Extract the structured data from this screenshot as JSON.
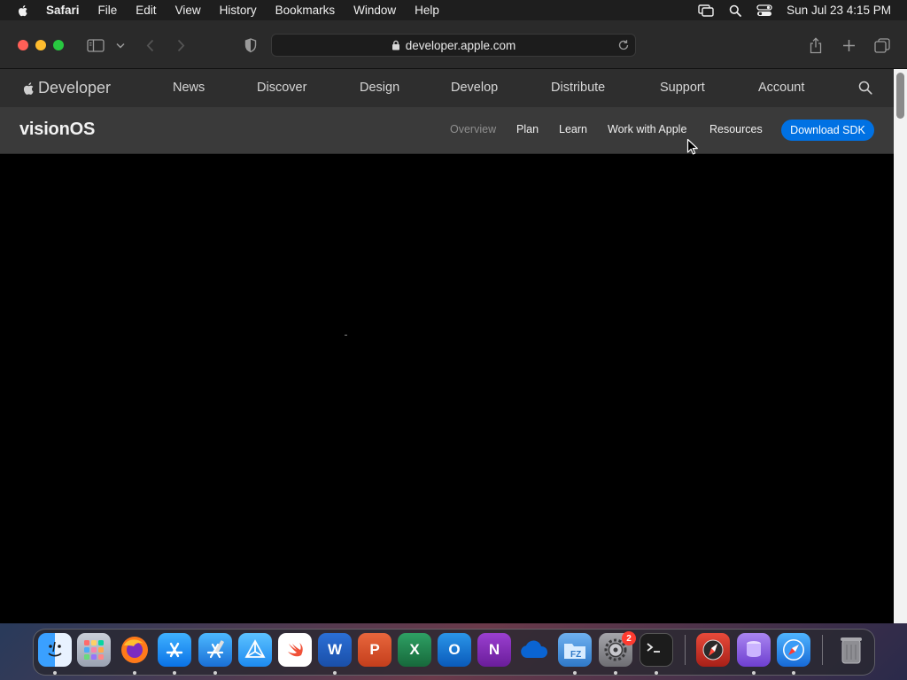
{
  "menubar": {
    "app": "Safari",
    "items": [
      "File",
      "Edit",
      "View",
      "History",
      "Bookmarks",
      "Window",
      "Help"
    ],
    "clock": "Sun Jul 23  4:15 PM"
  },
  "toolbar": {
    "url": "developer.apple.com"
  },
  "globalnav": {
    "brand": "Developer",
    "items": [
      "News",
      "Discover",
      "Design",
      "Develop",
      "Distribute",
      "Support",
      "Account"
    ]
  },
  "localnav": {
    "product": "visionOS",
    "items": [
      "Overview",
      "Plan",
      "Learn",
      "Work with Apple",
      "Resources"
    ],
    "current": "Overview",
    "cta": "Download SDK"
  },
  "dock": {
    "apps": [
      {
        "name": "Finder",
        "color": "#1e90ff"
      },
      {
        "name": "Launchpad",
        "color": "#b0b8c8"
      },
      {
        "name": "Firefox",
        "color": "#ff7a1a"
      },
      {
        "name": "App Store",
        "color": "#1a8cff"
      },
      {
        "name": "Xcode",
        "color": "#1a7bd6"
      },
      {
        "name": "Instruments",
        "color": "#2a9cff"
      },
      {
        "name": "Swift Playgrounds",
        "color": "#f05138"
      },
      {
        "name": "Microsoft Word",
        "color": "#2b579a"
      },
      {
        "name": "Microsoft PowerPoint",
        "color": "#d24726"
      },
      {
        "name": "Microsoft Excel",
        "color": "#217346"
      },
      {
        "name": "Microsoft Outlook",
        "color": "#0078d4"
      },
      {
        "name": "Microsoft OneNote",
        "color": "#7719aa"
      },
      {
        "name": "OneDrive",
        "color": "#0a64d2"
      },
      {
        "name": "FileZilla",
        "color": "#3b8ad9"
      },
      {
        "name": "System Settings",
        "color": "#8e8e93"
      },
      {
        "name": "Terminal",
        "color": "#1c1c1c"
      },
      {
        "name": "Safari Technology Preview",
        "color": "#c0392b"
      },
      {
        "name": "Reality Composer Pro",
        "color": "#8e5de8"
      },
      {
        "name": "Safari",
        "color": "#1e88e5"
      },
      {
        "name": "Trash",
        "color": "#6e6e73"
      }
    ],
    "settings_badge": "2"
  }
}
